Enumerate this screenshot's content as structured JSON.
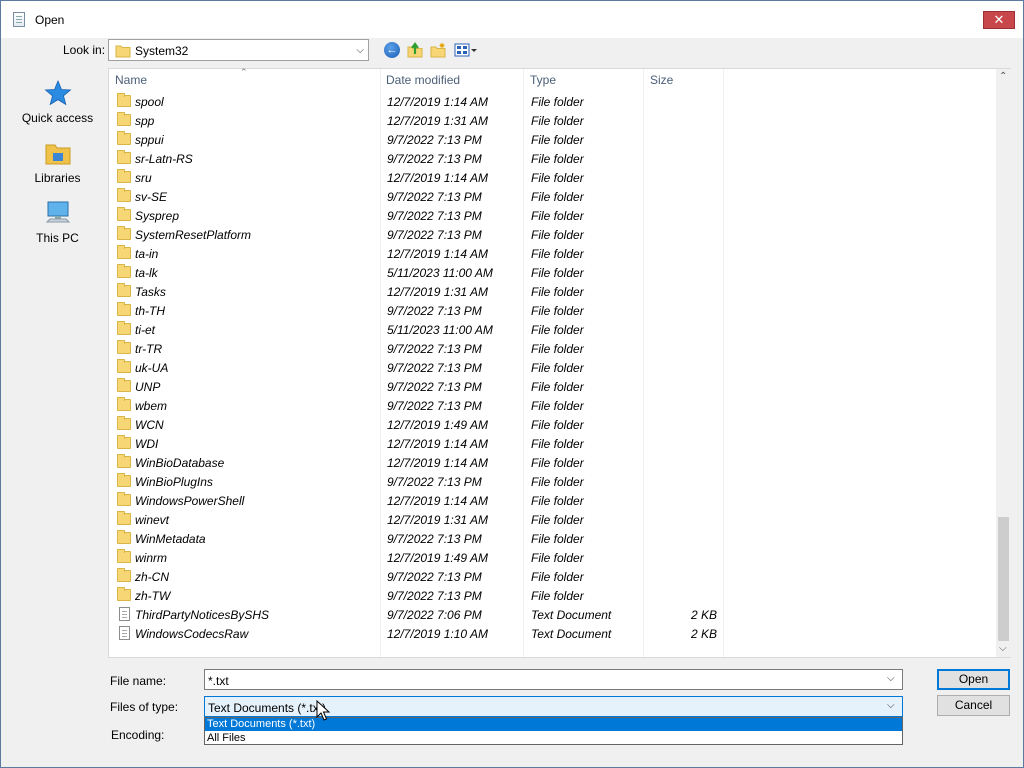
{
  "window": {
    "title": "Open"
  },
  "look_in": {
    "label": "Look in:",
    "value": "System32"
  },
  "places": [
    {
      "label": "Quick access",
      "icon": "star-icon"
    },
    {
      "label": "Libraries",
      "icon": "libraries-icon"
    },
    {
      "label": "This PC",
      "icon": "computer-icon"
    }
  ],
  "columns": {
    "name": "Name",
    "date": "Date modified",
    "type": "Type",
    "size": "Size"
  },
  "rows": [
    {
      "name": "spool",
      "date": "12/7/2019 1:14 AM",
      "type": "File folder",
      "size": ""
    },
    {
      "name": "spp",
      "date": "12/7/2019 1:31 AM",
      "type": "File folder",
      "size": ""
    },
    {
      "name": "sppui",
      "date": "9/7/2022 7:13 PM",
      "type": "File folder",
      "size": ""
    },
    {
      "name": "sr-Latn-RS",
      "date": "9/7/2022 7:13 PM",
      "type": "File folder",
      "size": ""
    },
    {
      "name": "sru",
      "date": "12/7/2019 1:14 AM",
      "type": "File folder",
      "size": ""
    },
    {
      "name": "sv-SE",
      "date": "9/7/2022 7:13 PM",
      "type": "File folder",
      "size": ""
    },
    {
      "name": "Sysprep",
      "date": "9/7/2022 7:13 PM",
      "type": "File folder",
      "size": ""
    },
    {
      "name": "SystemResetPlatform",
      "date": "9/7/2022 7:13 PM",
      "type": "File folder",
      "size": ""
    },
    {
      "name": "ta-in",
      "date": "12/7/2019 1:14 AM",
      "type": "File folder",
      "size": ""
    },
    {
      "name": "ta-lk",
      "date": "5/11/2023 11:00 AM",
      "type": "File folder",
      "size": ""
    },
    {
      "name": "Tasks",
      "date": "12/7/2019 1:31 AM",
      "type": "File folder",
      "size": ""
    },
    {
      "name": "th-TH",
      "date": "9/7/2022 7:13 PM",
      "type": "File folder",
      "size": ""
    },
    {
      "name": "ti-et",
      "date": "5/11/2023 11:00 AM",
      "type": "File folder",
      "size": ""
    },
    {
      "name": "tr-TR",
      "date": "9/7/2022 7:13 PM",
      "type": "File folder",
      "size": ""
    },
    {
      "name": "uk-UA",
      "date": "9/7/2022 7:13 PM",
      "type": "File folder",
      "size": ""
    },
    {
      "name": "UNP",
      "date": "9/7/2022 7:13 PM",
      "type": "File folder",
      "size": ""
    },
    {
      "name": "wbem",
      "date": "9/7/2022 7:13 PM",
      "type": "File folder",
      "size": ""
    },
    {
      "name": "WCN",
      "date": "12/7/2019 1:49 AM",
      "type": "File folder",
      "size": ""
    },
    {
      "name": "WDI",
      "date": "12/7/2019 1:14 AM",
      "type": "File folder",
      "size": ""
    },
    {
      "name": "WinBioDatabase",
      "date": "12/7/2019 1:14 AM",
      "type": "File folder",
      "size": ""
    },
    {
      "name": "WinBioPlugIns",
      "date": "9/7/2022 7:13 PM",
      "type": "File folder",
      "size": ""
    },
    {
      "name": "WindowsPowerShell",
      "date": "12/7/2019 1:14 AM",
      "type": "File folder",
      "size": ""
    },
    {
      "name": "winevt",
      "date": "12/7/2019 1:31 AM",
      "type": "File folder",
      "size": ""
    },
    {
      "name": "WinMetadata",
      "date": "9/7/2022 7:13 PM",
      "type": "File folder",
      "size": ""
    },
    {
      "name": "winrm",
      "date": "12/7/2019 1:49 AM",
      "type": "File folder",
      "size": ""
    },
    {
      "name": "zh-CN",
      "date": "9/7/2022 7:13 PM",
      "type": "File folder",
      "size": ""
    },
    {
      "name": "zh-TW",
      "date": "9/7/2022 7:13 PM",
      "type": "File folder",
      "size": ""
    },
    {
      "name": "ThirdPartyNoticesBySHS",
      "date": "9/7/2022 7:06 PM",
      "type": "Text Document",
      "size": "2 KB"
    },
    {
      "name": "WindowsCodecsRaw",
      "date": "12/7/2019 1:10 AM",
      "type": "Text Document",
      "size": "2 KB"
    }
  ],
  "file_name": {
    "label": "File name:",
    "value": "*.txt"
  },
  "file_type": {
    "label": "Files of type:",
    "value": "Text Documents (*.txt)",
    "options": [
      "Text Documents (*.txt)",
      "All Files"
    ]
  },
  "encoding": {
    "label": "Encoding:"
  },
  "buttons": {
    "open": "Open",
    "cancel": "Cancel"
  }
}
